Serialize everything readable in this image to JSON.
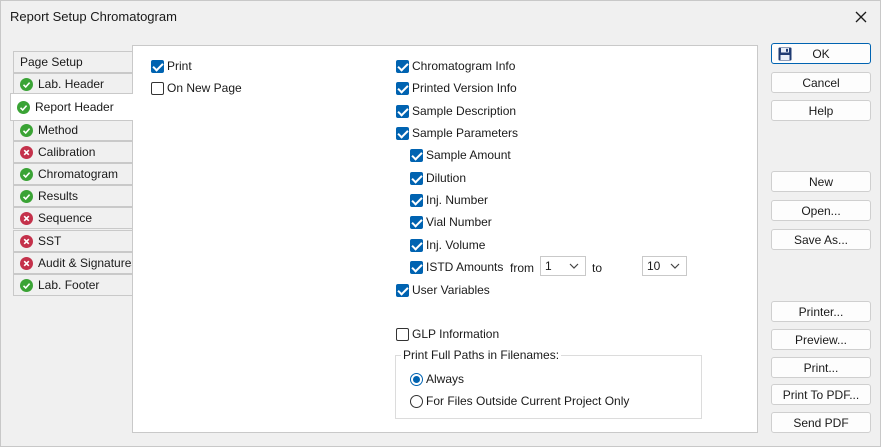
{
  "window": {
    "title": "Report Setup Chromatogram"
  },
  "tabs": [
    {
      "label": "Page Setup",
      "status": "none"
    },
    {
      "label": "Lab. Header",
      "status": "ok"
    },
    {
      "label": "Report Header",
      "status": "ok",
      "active": true
    },
    {
      "label": "Method",
      "status": "ok"
    },
    {
      "label": "Calibration",
      "status": "error"
    },
    {
      "label": "Chromatogram",
      "status": "ok"
    },
    {
      "label": "Results",
      "status": "ok"
    },
    {
      "label": "Sequence",
      "status": "error"
    },
    {
      "label": "SST",
      "status": "error"
    },
    {
      "label": "Audit & Signatures",
      "status": "error"
    },
    {
      "label": "Lab. Footer",
      "status": "ok"
    }
  ],
  "panel": {
    "print": {
      "label": "Print",
      "checked": true
    },
    "on_new_page": {
      "label": "On New Page",
      "checked": false
    },
    "chromatogram_info": {
      "label": "Chromatogram Info",
      "checked": true
    },
    "printed_version_info": {
      "label": "Printed Version Info",
      "checked": true
    },
    "sample_description": {
      "label": "Sample Description",
      "checked": true
    },
    "sample_parameters": {
      "label": "Sample Parameters",
      "checked": true
    },
    "sample_amount": {
      "label": "Sample Amount",
      "checked": true
    },
    "dilution": {
      "label": "Dilution",
      "checked": true
    },
    "inj_number": {
      "label": "Inj. Number",
      "checked": true
    },
    "vial_number": {
      "label": "Vial Number",
      "checked": true
    },
    "inj_volume": {
      "label": "Inj. Volume",
      "checked": true
    },
    "istd_amounts": {
      "label": "ISTD Amounts",
      "checked": true
    },
    "istd_from_label": "from",
    "istd_from_value": "1",
    "istd_to_label": "to",
    "istd_to_value": "10",
    "user_variables": {
      "label": "User Variables",
      "checked": true
    },
    "glp_information": {
      "label": "GLP Information",
      "checked": false
    },
    "full_paths_group_label": "Print Full Paths in Filenames:",
    "radio_always": {
      "label": "Always",
      "selected": true
    },
    "radio_outside": {
      "label": "For Files Outside Current Project Only",
      "selected": false
    }
  },
  "buttons": {
    "ok": "OK",
    "cancel": "Cancel",
    "help": "Help",
    "new": "New",
    "open": "Open...",
    "save_as": "Save As...",
    "printer": "Printer...",
    "preview": "Preview...",
    "print": "Print...",
    "print_to_pdf": "Print To PDF...",
    "send_pdf": "Send PDF"
  },
  "colors": {
    "accent": "#0063b1",
    "ok_status": "#3aa335",
    "error_status": "#c4314b"
  },
  "icons": {
    "ok": "check-circle-icon",
    "error": "x-circle-icon",
    "save": "floppy-disk-icon",
    "close": "close-icon"
  }
}
